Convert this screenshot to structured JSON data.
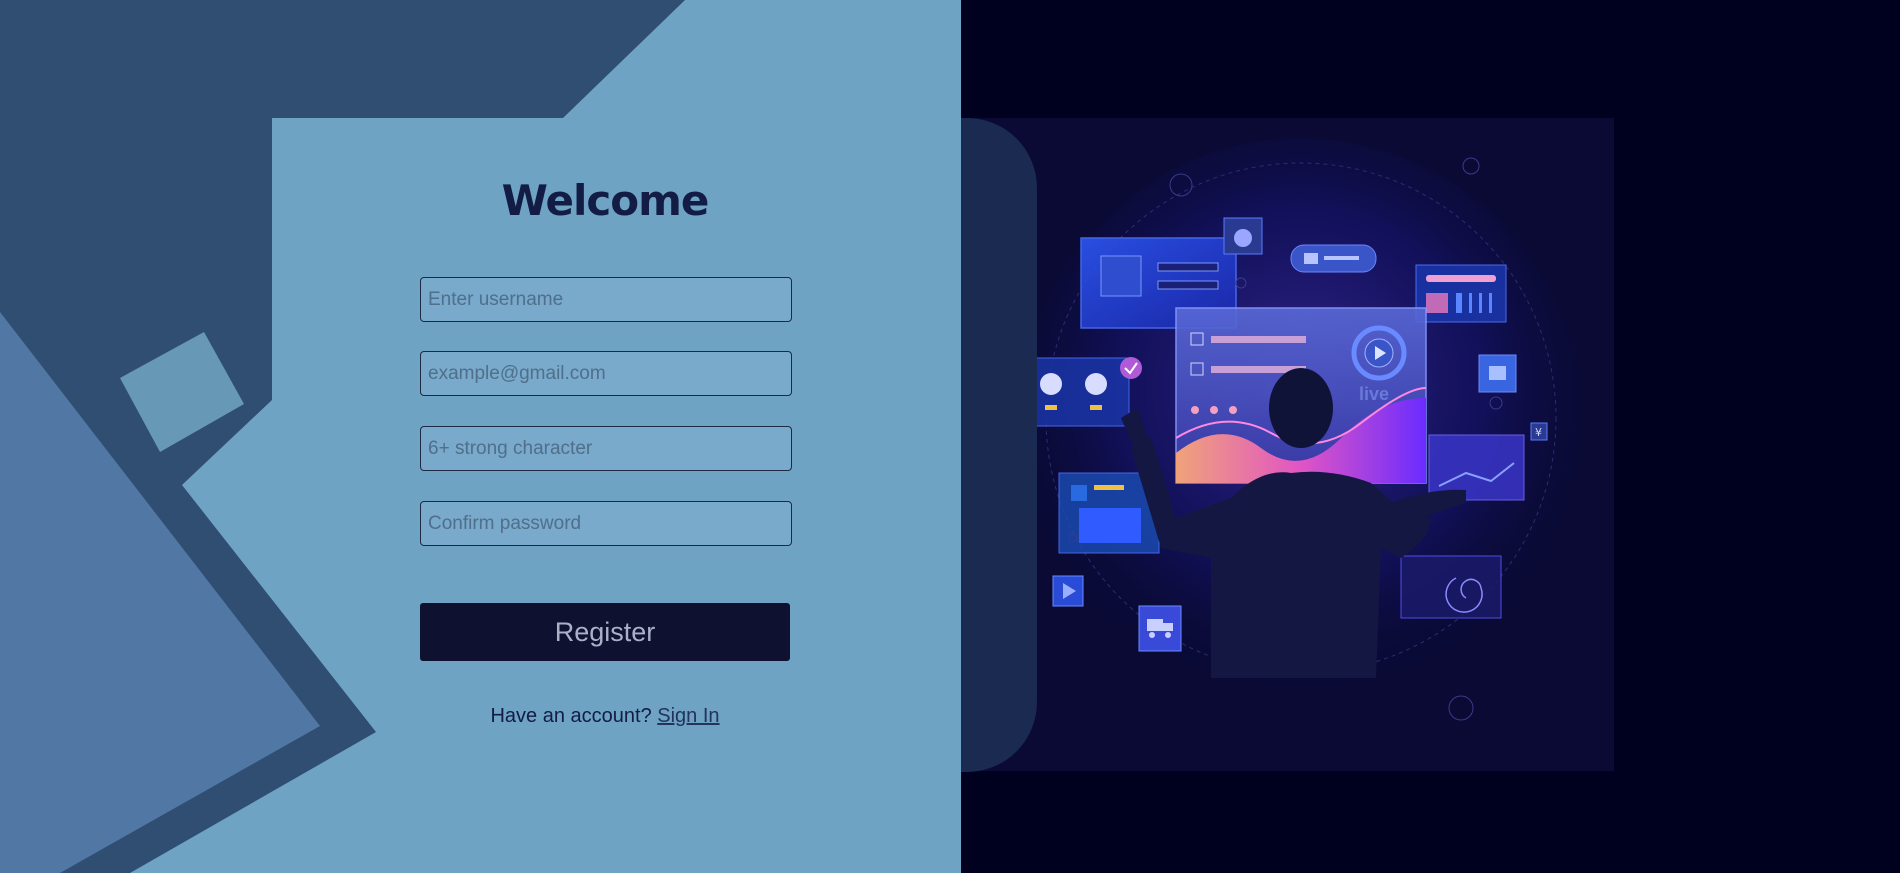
{
  "form": {
    "title": "Welcome",
    "username_placeholder": "Enter username",
    "email_placeholder": "example@gmail.com",
    "password_placeholder": "6+ strong character",
    "confirm_placeholder": "Confirm password",
    "register_label": "Register",
    "have_account_text": "Have an account?",
    "signin_label": "Sign In"
  },
  "illustration": {
    "live_label": "live",
    "currency_symbol": "¥"
  },
  "colors": {
    "page_background": "#00001f",
    "form_panel": "#6ea3c4",
    "dark_shape": "#2f4e72",
    "button": "#0f1131",
    "title_text": "#131c44",
    "accent_pink": "#e055c4",
    "accent_blue": "#2f5bff"
  }
}
